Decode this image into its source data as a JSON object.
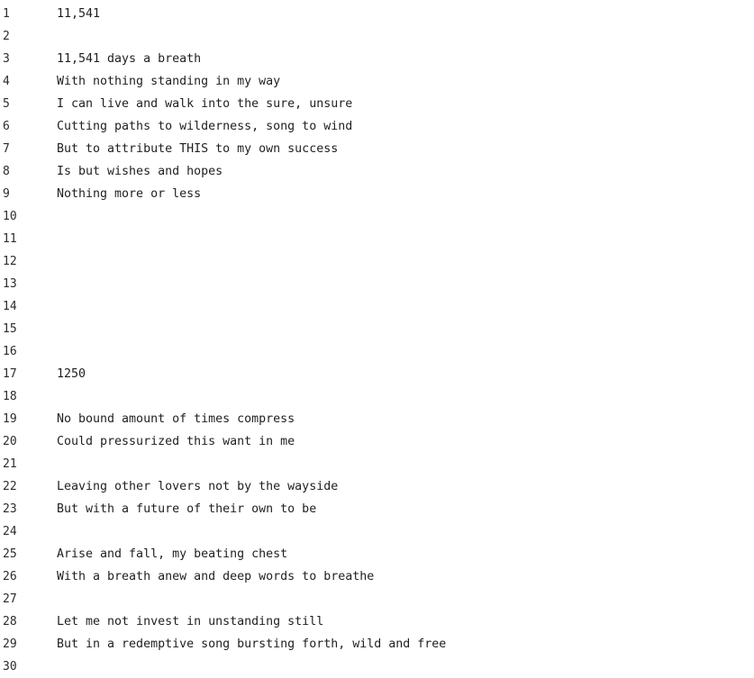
{
  "lines": [
    {
      "number": "1",
      "text": "11,541"
    },
    {
      "number": "2",
      "text": ""
    },
    {
      "number": "3",
      "text": "11,541 days a breath"
    },
    {
      "number": "4",
      "text": "With nothing standing in my way"
    },
    {
      "number": "5",
      "text": "I can live and walk into the sure, unsure"
    },
    {
      "number": "6",
      "text": "Cutting paths to wilderness, song to wind"
    },
    {
      "number": "7",
      "text": "But to attribute THIS to my own success"
    },
    {
      "number": "8",
      "text": "Is but wishes and hopes"
    },
    {
      "number": "9",
      "text": "Nothing more or less"
    },
    {
      "number": "10",
      "text": ""
    },
    {
      "number": "11",
      "text": ""
    },
    {
      "number": "12",
      "text": ""
    },
    {
      "number": "13",
      "text": ""
    },
    {
      "number": "14",
      "text": ""
    },
    {
      "number": "15",
      "text": ""
    },
    {
      "number": "16",
      "text": ""
    },
    {
      "number": "17",
      "text": "1250"
    },
    {
      "number": "18",
      "text": ""
    },
    {
      "number": "19",
      "text": "No bound amount of times compress"
    },
    {
      "number": "20",
      "text": "Could pressurized this want in me"
    },
    {
      "number": "21",
      "text": ""
    },
    {
      "number": "22",
      "text": "Leaving other lovers not by the wayside"
    },
    {
      "number": "23",
      "text": "But with a future of their own to be"
    },
    {
      "number": "24",
      "text": ""
    },
    {
      "number": "25",
      "text": "Arise and fall, my beating chest"
    },
    {
      "number": "26",
      "text": "With a breath anew and deep words to breathe"
    },
    {
      "number": "27",
      "text": ""
    },
    {
      "number": "28",
      "text": "Let me not invest in unstanding still"
    },
    {
      "number": "29",
      "text": "But in a redemptive song bursting forth, wild and free"
    },
    {
      "number": "30",
      "text": ""
    }
  ]
}
